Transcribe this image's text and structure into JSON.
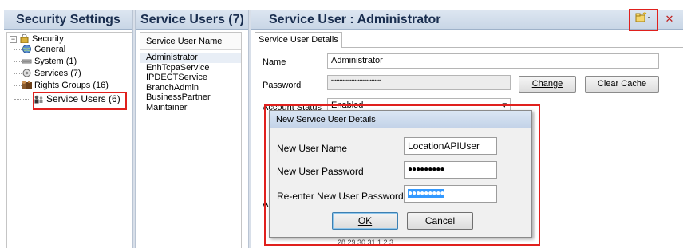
{
  "panels": {
    "left_title": "Security Settings",
    "middle_title": "Service Users (7)",
    "right_title": "Service User :  Administrator"
  },
  "tree": {
    "root": "Security",
    "items": [
      {
        "label": "General",
        "icon": "globe-icon"
      },
      {
        "label": "System (1)",
        "icon": "system-icon"
      },
      {
        "label": "Services (7)",
        "icon": "services-icon"
      },
      {
        "label": "Rights Groups (16)",
        "icon": "rights-groups-icon"
      },
      {
        "label": "Service Users (6)",
        "icon": "users-icon"
      }
    ]
  },
  "service_users": {
    "column_header": "Service User Name",
    "items": [
      "Administrator",
      "EnhTcpaService",
      "IPDECTService",
      "BranchAdmin",
      "BusinessPartner",
      "Maintainer"
    ]
  },
  "details": {
    "tab_label": "Service User Details",
    "name_label": "Name",
    "name_value": "Administrator",
    "password_label": "Password",
    "password_value": "••••••••••••••••••••••••••••••",
    "change_button": "Change",
    "clear_cache_button": "Clear Cache",
    "account_status_label": "Account Status",
    "account_status_value": "Enabled",
    "partial_label": "A",
    "calendar_partial": "28  29  30  31  1  2  3"
  },
  "toolbar": {
    "new_icon": "new-folder-icon",
    "dropdown_icon": "▾",
    "close_icon": "✕"
  },
  "dialog": {
    "title": "New Service User Details",
    "new_user_name_label": "New User Name",
    "new_user_name_value": "LocationAPIUser",
    "new_user_password_label": "New User Password",
    "new_user_password_value": "●●●●●●●●●",
    "reenter_label": "Re-enter New User Password",
    "reenter_value": "●●●●●●●●●",
    "ok_button": "OK",
    "cancel_button": "Cancel"
  },
  "colors": {
    "highlight": "#e0201d",
    "header_text": "#1a2e4f",
    "selection": "#3399ff"
  }
}
